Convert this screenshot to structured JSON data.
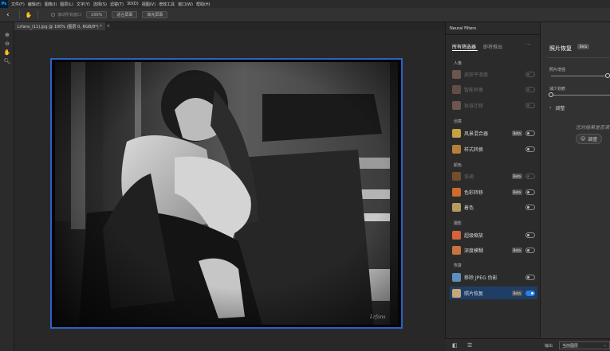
{
  "menubar": {
    "logo": "Ps",
    "items": [
      "文件(F)",
      "编辑(E)",
      "图像(I)",
      "图层(L)",
      "文字(Y)",
      "选择(S)",
      "滤镜(T)",
      "3D(D)",
      "视图(V)",
      "增效工具",
      "窗口(W)",
      "帮助(H)"
    ]
  },
  "options": {
    "scroll_all_label": "滚动所有窗口",
    "zoom_value": "100%",
    "fit_screen": "适合屏幕",
    "fill_screen": "填充屏幕"
  },
  "document": {
    "tab_title": "Lrfans_(11).jpg @ 100% (图层 0, RGB/8*) *",
    "close": "×",
    "signature": "Lrfans"
  },
  "neural_filters": {
    "panel_title": "Neural Filters",
    "tabs": {
      "all": "所有筛选器",
      "coming": "即将推出",
      "more": "···"
    },
    "categories": {
      "portrait": "人像",
      "creative": "创意",
      "color": "颜色",
      "photography": "摄影",
      "restoration": "恢复"
    },
    "filters": [
      {
        "name": "皮肤平滑度",
        "beta": false,
        "enabled": false,
        "disabled": true,
        "thumb": "#b98f76"
      },
      {
        "name": "智能肖像",
        "beta": false,
        "enabled": false,
        "disabled": true,
        "thumb": "#a87a66"
      },
      {
        "name": "妆容迁移",
        "beta": false,
        "enabled": false,
        "disabled": true,
        "thumb": "#c08a7a"
      },
      {
        "name": "风景混合器",
        "beta": true,
        "enabled": false,
        "disabled": false,
        "thumb": "#c8a044"
      },
      {
        "name": "样式转换",
        "beta": false,
        "enabled": false,
        "disabled": false,
        "thumb": "#b6803a"
      },
      {
        "name": "协调",
        "beta": true,
        "enabled": false,
        "disabled": true,
        "thumb": "#c97a2e"
      },
      {
        "name": "色彩转移",
        "beta": true,
        "enabled": false,
        "disabled": false,
        "thumb": "#d06a2a"
      },
      {
        "name": "着色",
        "beta": false,
        "enabled": false,
        "disabled": false,
        "thumb": "#b59a62"
      },
      {
        "name": "超级缩放",
        "beta": false,
        "enabled": false,
        "disabled": false,
        "thumb": "#d4623a"
      },
      {
        "name": "深度模糊",
        "beta": true,
        "enabled": false,
        "disabled": false,
        "thumb": "#c8743e"
      },
      {
        "name": "移除 JPEG 伪影",
        "beta": false,
        "enabled": false,
        "disabled": false,
        "thumb": "#5c8fc0"
      },
      {
        "name": "照片恢复",
        "beta": true,
        "enabled": true,
        "disabled": false,
        "selected": true,
        "thumb": "#c6a878"
      }
    ],
    "beta_label": "Beta"
  },
  "filter_settings": {
    "title": "照片恢复",
    "beta": "Beta",
    "slider1_label": "照片增强",
    "slider1_value": 1.0,
    "slider2_label": "减少划痕",
    "slider2_value": 0.0,
    "adjust_label": "调整",
    "hint": "您对结果是否满",
    "survey": "调查"
  },
  "bottom": {
    "output_label": "输出",
    "output_value": "当前图层"
  },
  "colors": {
    "selection_border": "#2b62c4",
    "toggle_on": "#2680eb",
    "selected_row": "#1f3e66"
  }
}
